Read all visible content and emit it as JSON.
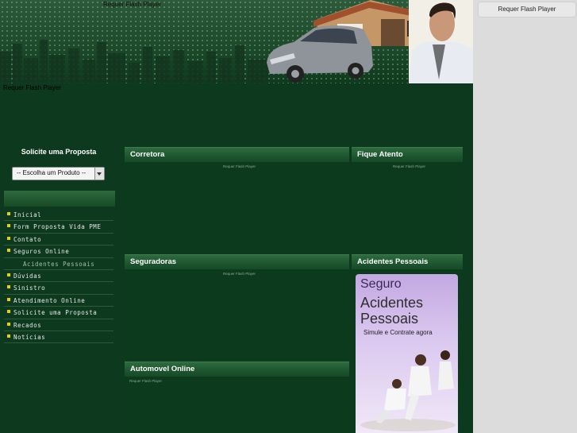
{
  "flash_placeholder": "Requer Flash Player",
  "sidebar": {
    "title": "Solicite uma Proposta",
    "select_value": "-- Escolha um Produto --",
    "menu": [
      {
        "label": "Inicial",
        "sub": false
      },
      {
        "label": "Form Proposta Vida PME",
        "sub": false
      },
      {
        "label": "Contato",
        "sub": false
      },
      {
        "label": "Seguros Online",
        "sub": false
      },
      {
        "label": "Acidentes Pessoais",
        "sub": true
      },
      {
        "label": "Dúvidas",
        "sub": false
      },
      {
        "label": "Sinistro",
        "sub": false
      },
      {
        "label": "Atendimento Online",
        "sub": false
      },
      {
        "label": "Solicite uma Proposta",
        "sub": false
      },
      {
        "label": "Recados",
        "sub": false
      },
      {
        "label": "Notícias",
        "sub": false
      }
    ]
  },
  "panels": {
    "corretora": "Corretora",
    "fique_atento": "Fique Atento",
    "seguradoras": "Seguradoras",
    "acidentes_pessoais": "Acidentes Pessoais",
    "automovel_online": "Automovel Online"
  },
  "ad": {
    "line1": "Seguro",
    "line2": "Acidentes",
    "line3": "Pessoais",
    "line4": "Simule e Contrate agora"
  },
  "colors": {
    "accent": "#e8d100",
    "background": "#0d3a1e"
  }
}
